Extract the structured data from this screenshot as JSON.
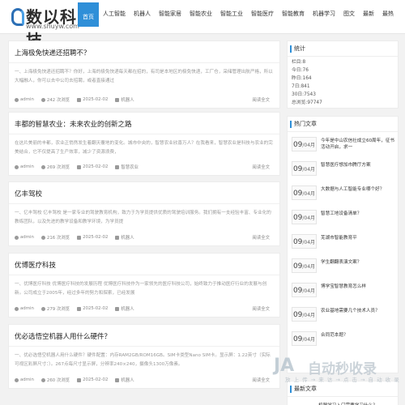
{
  "header": {
    "logo_text": "数以科技",
    "logo_url": "www.shuyw.com",
    "nav": [
      "首页",
      "人工智能",
      "机器人",
      "智能家居",
      "智能农业",
      "智能工业",
      "智能医疗",
      "智能教育",
      "机器学习",
      "图文",
      "最新",
      "最热"
    ]
  },
  "posts": [
    {
      "title": "上海极免快递还招聘不？",
      "excerpt": "一、上海极免快递还招聘不？你好，上海的极免快递每天都在招的，有司是本地区的极免快递，工厂仓，采储管理出航严格，所以大幅融人，你可以去中公司去招聘，或者直接通过",
      "author": "admin",
      "views": "242 次浏览",
      "date": "2025-02-02",
      "category": "机器人",
      "more": "阅读全文"
    },
    {
      "title": "丰都的智慧农业：未来农业的创新之路",
      "excerpt": "在这片美丽的丰都，农业正悄然发生着翻天覆地的变化。城市中央的，智慧农业欣喜万人？在我看来，智慧农业是科技与农业的完美结合，它不仅提高了生产效率，减少了资源浪费，",
      "author": "admin",
      "views": "269 次浏览",
      "date": "2025-02-02",
      "category": "智慧农业",
      "more": "阅读全文"
    },
    {
      "title": "亿丰驾校",
      "excerpt": "一、亿丰驾校 亿丰驾校 是一家专业的驾驶教育机构，致力于为学员提供优质的驾驶培训服务。我们拥有一支经验丰富、专业化的教练团队，以及先进的教学设备和教学环境，为学员提",
      "author": "admin",
      "views": "216 次浏览",
      "date": "2025-02-02",
      "category": "机器人",
      "more": "阅读全文"
    },
    {
      "title": "优博医疗科技",
      "excerpt": "一、优博医疗科技 优博医疗科技的发展历程 优博医疗科技作为一家领先的医疗科技公司，始终致力于推动医疗行业的发展与创新。公司成立于2005年，经过多年的努力和探索，已经发展",
      "author": "admin",
      "views": "279 次浏览",
      "date": "2025-02-02",
      "category": "机器人",
      "more": "阅读全文"
    },
    {
      "title": "优必选悟空机器人用什么硬件？",
      "excerpt": "一、优必选悟空机器人用什么硬件？硬件配置：内存RAM2GB/ROM16GB。SIM卡类型Nano SIM卡。显示屏：1.22英寸（实际可视区彩屏尺寸：）。267点每尺寸显示屏，分辨率240×240，摄像头1300万像素。",
      "author": "admin",
      "views": "260 次浏览",
      "date": "2025-02-02",
      "category": "机器人",
      "more": "阅读全文"
    }
  ],
  "stats": {
    "heading": "统计",
    "lines": [
      "栏目:8",
      "今日:76",
      "昨日:164",
      "7日:841",
      "30日:7543",
      "总浏览:97747"
    ]
  },
  "hot": {
    "heading": "热门文章",
    "items": [
      {
        "day": "09",
        "month": "/04月",
        "title": "今年是中山农信社成立60周年，征书活动开启，求一"
      },
      {
        "day": "09",
        "month": "/04月",
        "title": "智慧医疗想加市腾厅方案"
      },
      {
        "day": "09",
        "month": "/04月",
        "title": "大数据与人工智能专业哪个好？"
      },
      {
        "day": "09",
        "month": "/04月",
        "title": "智慧工地设备清单？"
      },
      {
        "day": "09",
        "month": "/04月",
        "title": "芜湖市智能教育平"
      },
      {
        "day": "09",
        "month": "/04月",
        "title": "学生翻翻表演文案？"
      },
      {
        "day": "09",
        "month": "/04月",
        "title": "博学宝智慧教育怎么样"
      },
      {
        "day": "09",
        "month": "/04月",
        "title": "农业基地需要几个技术人员？"
      },
      {
        "day": "09",
        "month": "/04月",
        "title": "合同范本题？"
      }
    ]
  },
  "sidebar_next": {
    "heading": "最新文章",
    "first_item": "机器学习入门需要学习什么？"
  },
  "watermark": {
    "logo": "JA",
    "text": "自动秒收录",
    "sub": "放 上 传 → 来 访 → 点 击 → 自 动 收 录"
  }
}
